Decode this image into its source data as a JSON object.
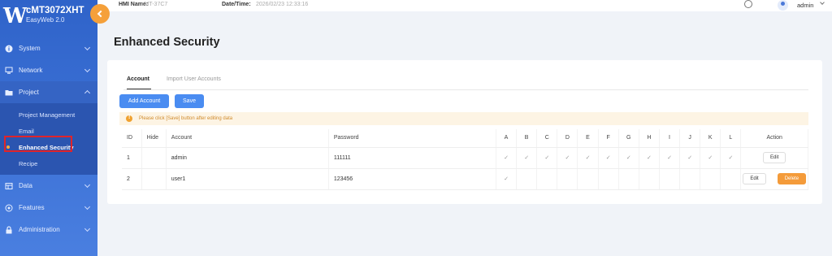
{
  "brand": {
    "logo": "W",
    "title": "cMT3072XHT",
    "subtitle": "EasyWeb 2.0"
  },
  "sidebar": {
    "items": [
      {
        "label": "System",
        "icon": "info-icon"
      },
      {
        "label": "Network",
        "icon": "network-icon"
      },
      {
        "label": "Project",
        "icon": "folder-icon"
      },
      {
        "label": "Data",
        "icon": "data-icon"
      },
      {
        "label": "Features",
        "icon": "features-icon"
      },
      {
        "label": "Administration",
        "icon": "lock-icon"
      }
    ],
    "project_sub": [
      "Project Management",
      "Email",
      "Enhanced Security",
      "Recipe"
    ],
    "active_sub": "Enhanced Security"
  },
  "topbar": {
    "hmi_label": "HMI Name:",
    "hmi_value": "cMT-37C7",
    "dt_label": "Date/Time:",
    "dt_value": "2026/02/23 12:33:16",
    "user": "admin"
  },
  "page_title": "Enhanced Security",
  "tabs": [
    "Account",
    "Import User Accounts"
  ],
  "buttons": {
    "add_account": "Add Account",
    "save": "Save"
  },
  "warning": "Please click [Save] button after editing data",
  "table": {
    "headers": [
      "ID",
      "Hide",
      "Account",
      "Password",
      "A",
      "B",
      "C",
      "D",
      "E",
      "F",
      "G",
      "H",
      "I",
      "J",
      "K",
      "L",
      "Action"
    ],
    "rows": [
      {
        "id": "1",
        "hide": "",
        "account": "admin",
        "password": "111111",
        "check": "✓",
        "edit": "Edit",
        "delete": ""
      },
      {
        "id": "2",
        "hide": "",
        "account": "user1",
        "password": "123456",
        "check": "✓",
        "edit": "Edit",
        "delete": "Delete"
      }
    ]
  },
  "colors": {
    "sidebar": "#3a6fd4",
    "accent": "#f5a03a",
    "button": "#4a8cf1"
  }
}
